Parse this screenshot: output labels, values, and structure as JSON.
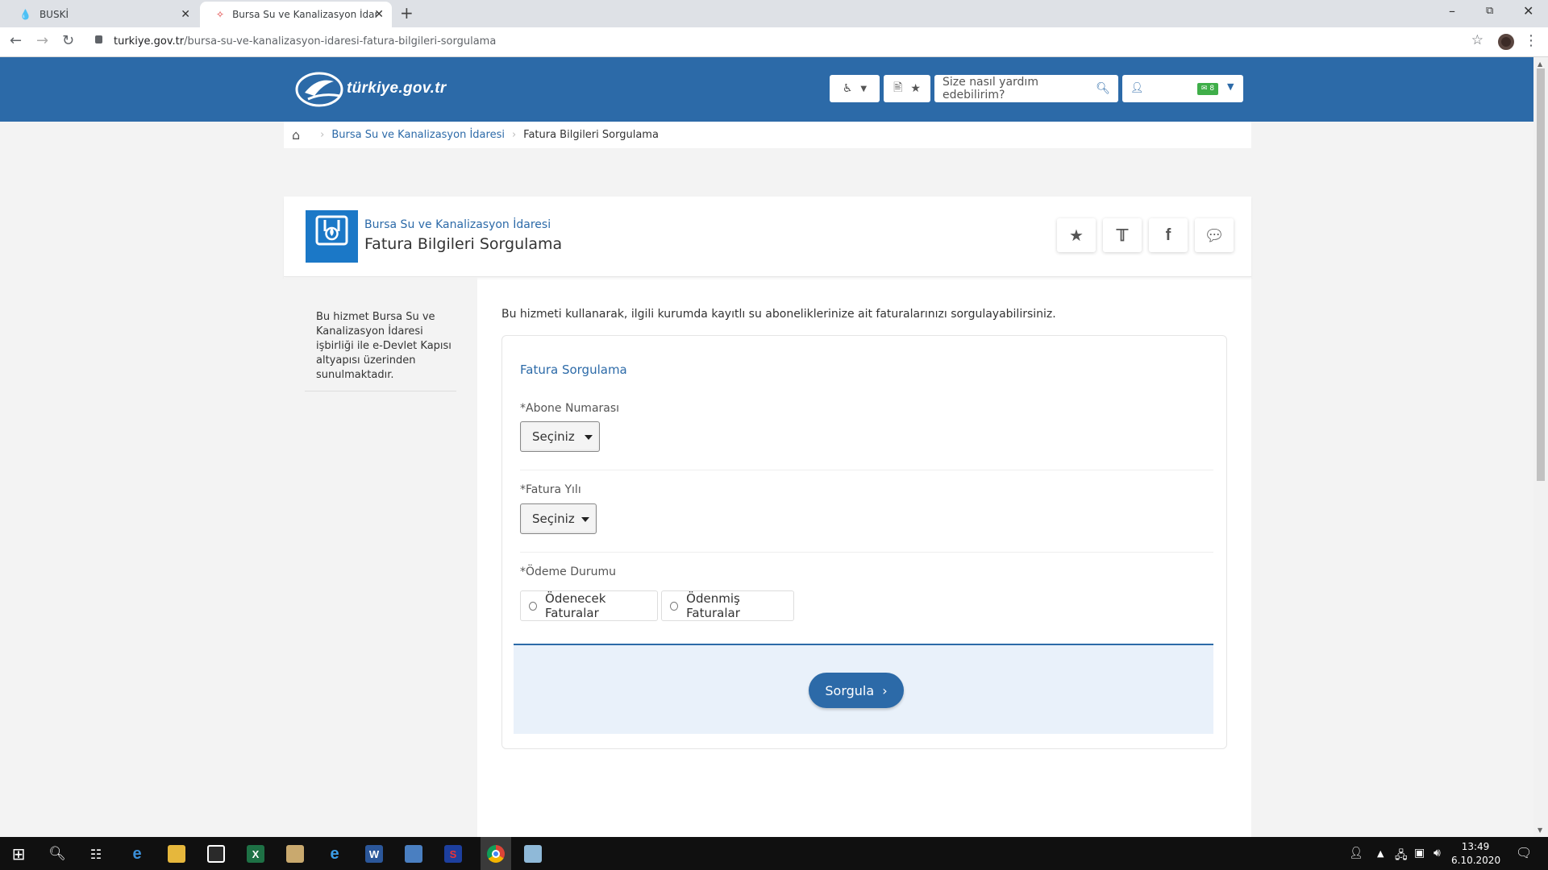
{
  "browser": {
    "tabs": [
      {
        "title": "BUSKİ",
        "active": false
      },
      {
        "title": "Bursa Su ve Kanalizasyon İdaresi",
        "active": true
      }
    ],
    "url_host": "turkiye.gov.tr",
    "url_path": "/bursa-su-ve-kanalizasyon-idaresi-fatura-bilgileri-sorgulama"
  },
  "header": {
    "logo_text": "türkiye.gov.tr",
    "search_placeholder": "Size nasıl yardım edebilirim?",
    "mail_count": "8",
    "brand_color": "#2c6aa8"
  },
  "breadcrumb": {
    "items": [
      "Bursa Su ve Kanalizasyon İdaresi",
      "Fatura Bilgileri Sorgulama"
    ]
  },
  "page": {
    "institution": "Bursa Su ve Kanalizasyon İdaresi",
    "title": "Fatura Bilgileri Sorgulama",
    "logo_label": "BUSKİ",
    "share_buttons": [
      "star-icon",
      "twitter-icon",
      "facebook-icon",
      "comment-icon"
    ],
    "sidebar_info": "Bu hizmet Bursa Su ve Kanalizasyon İdaresi işbirliği ile e-Devlet Kapısı altyapısı üzerinden sunulmaktadır.",
    "description": "Bu hizmeti kullanarak, ilgili kurumda kayıtlı su aboneliklerinize ait faturalarınızı sorgulayabilirsiniz."
  },
  "form": {
    "title": "Fatura Sorgulama",
    "abone_label": "*Abone Numarası",
    "abone_value": "Seçiniz",
    "yil_label": "*Fatura Yılı",
    "yil_value": "Seçiniz",
    "odeme_label": "*Ödeme Durumu",
    "odeme_options": [
      "Ödenecek Faturalar",
      "Ödenmiş Faturalar"
    ],
    "submit_label": "Sorgula"
  },
  "taskbar": {
    "time": "13:49",
    "date": "6.10.2020"
  }
}
